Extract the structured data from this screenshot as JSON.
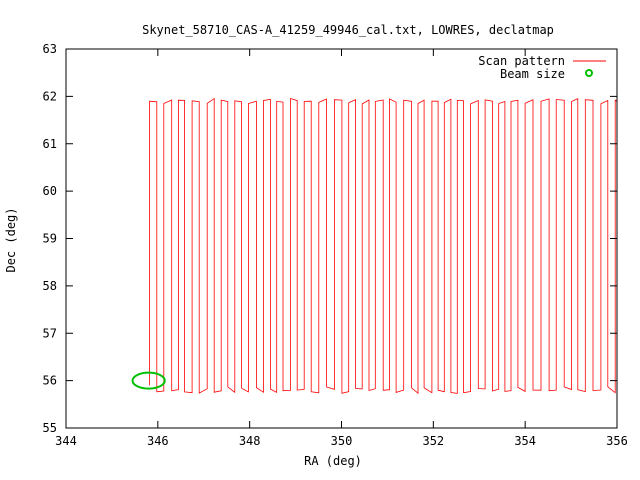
{
  "chart_data": {
    "type": "line",
    "title": "Skynet_58710_CAS-A_41259_49946_cal.txt, LOWRES, declatmap",
    "xlabel": "RA (deg)",
    "ylabel": "Dec (deg)",
    "xlim": [
      344,
      356
    ],
    "ylim": [
      55,
      63
    ],
    "xticks": [
      "344",
      "346",
      "348",
      "350",
      "352",
      "354",
      "356"
    ],
    "yticks": [
      "55",
      "56",
      "57",
      "58",
      "59",
      "60",
      "61",
      "62",
      "63"
    ],
    "grid": false,
    "legend": "top-right",
    "series": [
      {
        "name": "Scan pattern",
        "kind": "line",
        "color": "#ff0000",
        "ra_start": 345.82,
        "ra_end": 356.0,
        "ra_step": 0.155,
        "dec_low": 55.8,
        "dec_high": 61.9
      },
      {
        "name": "Beam size",
        "kind": "circle",
        "color": "#00c000",
        "center": [
          345.8,
          56.0
        ],
        "radius_deg": 0.35
      }
    ]
  }
}
